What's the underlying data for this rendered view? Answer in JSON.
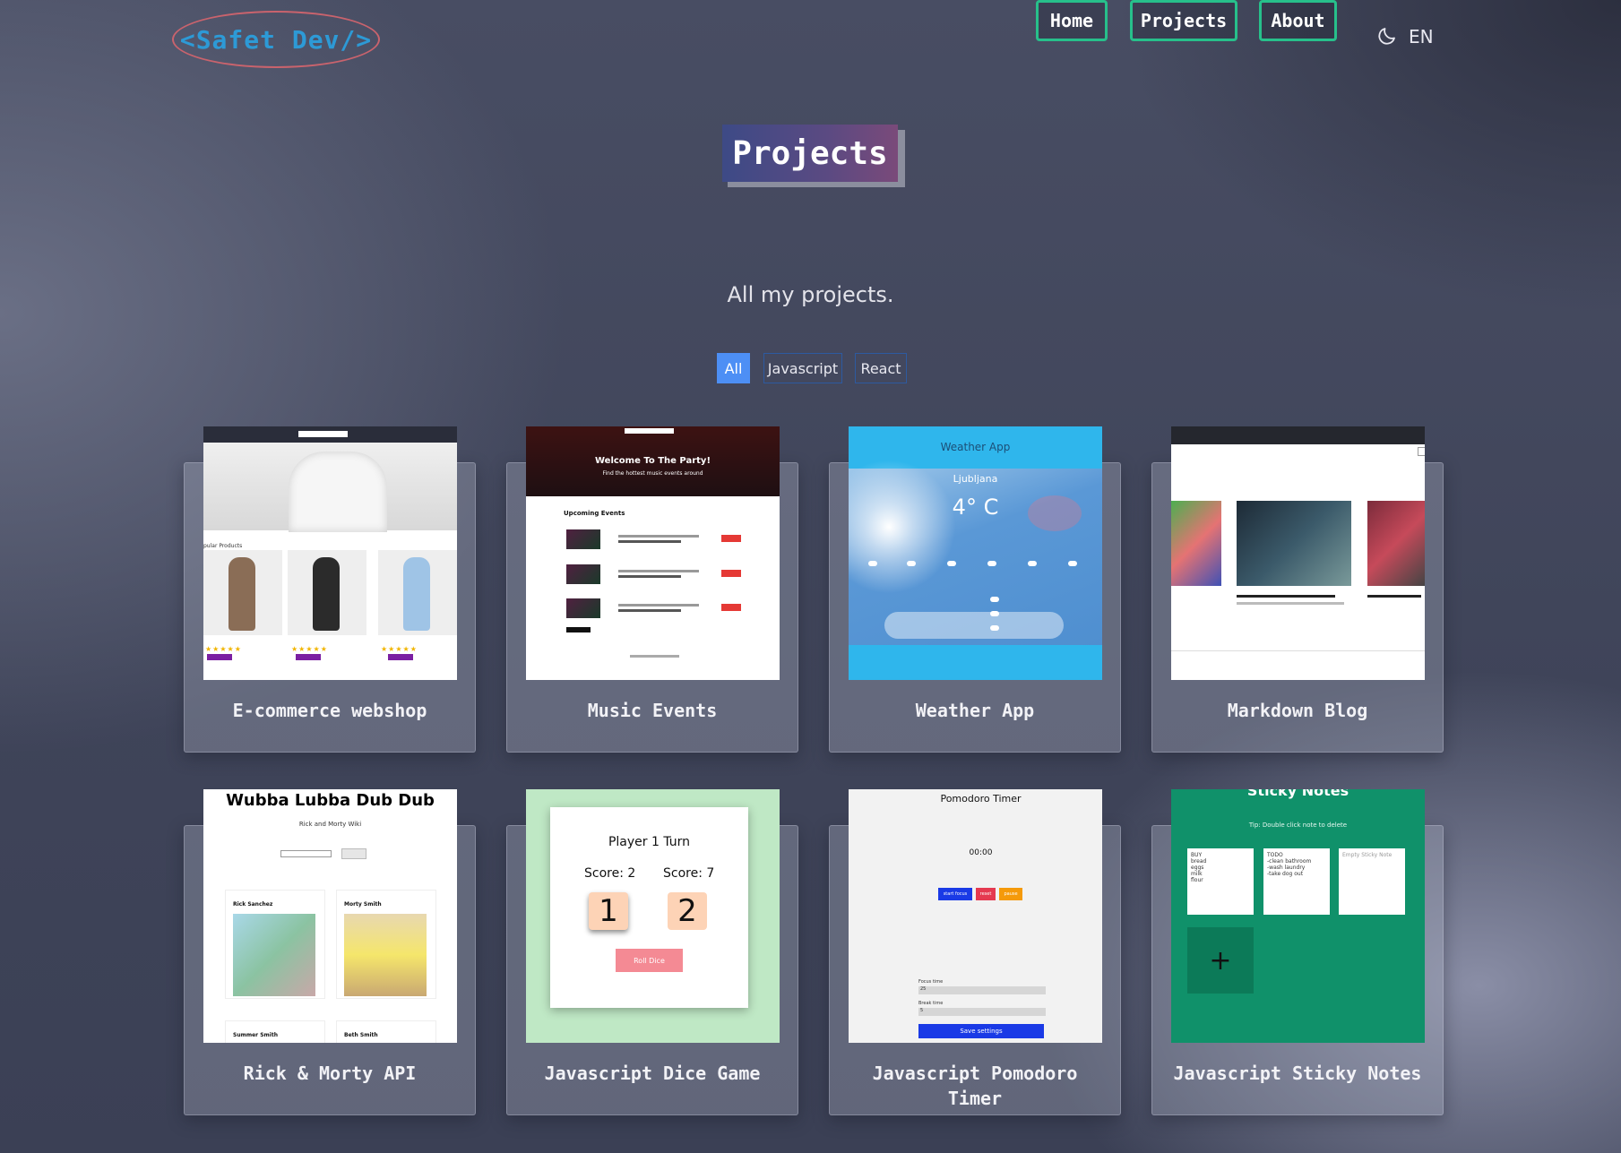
{
  "header": {
    "logo": "<Safet Dev/>",
    "nav": [
      {
        "label": "Home"
      },
      {
        "label": "Projects"
      },
      {
        "label": "About"
      }
    ],
    "theme_icon": "moon-icon",
    "language": "EN"
  },
  "page": {
    "title": "Projects",
    "subtitle": "All my projects."
  },
  "filters": [
    {
      "label": "All",
      "active": true
    },
    {
      "label": "Javascript",
      "active": false
    },
    {
      "label": "React",
      "active": false
    }
  ],
  "projects": [
    {
      "title": "E-commerce webshop"
    },
    {
      "title": "Music Events"
    },
    {
      "title": "Weather App"
    },
    {
      "title": "Markdown Blog"
    },
    {
      "title": "Rick & Morty API"
    },
    {
      "title": "Javascript Dice Game"
    },
    {
      "title": "Javascript Pomodoro Timer"
    },
    {
      "title": "Javascript Sticky Notes"
    }
  ],
  "thumbs": {
    "music": {
      "hero_title": "Welcome To The Party!",
      "hero_sub": "Find the hottest music events around",
      "section": "Upcoming Events"
    },
    "weather": {
      "header": "Weather App",
      "city": "Ljubljana",
      "temp": "4° C"
    },
    "rickmorty": {
      "title": "Wubba Lubba Dub Dub",
      "sub": "Rick and Morty Wiki",
      "names": [
        "Rick Sanchez",
        "Morty Smith",
        "Summer Smith",
        "Beth Smith"
      ]
    },
    "dice": {
      "turn": "Player 1 Turn",
      "score1": "Score: 2",
      "score2": "Score: 7",
      "die1": "1",
      "die2": "2",
      "roll": "Roll Dice"
    },
    "pomodoro": {
      "title": "Pomodoro Timer",
      "time": "00:00",
      "start": "start focus",
      "reset": "reset",
      "pause": "pause",
      "focus_label": "Focus time",
      "focus_value": "25",
      "break_label": "Break time",
      "break_value": "5",
      "save": "Save settings"
    },
    "sticky": {
      "title": "Sticky Notes",
      "tip": "Tip: Double click note to delete",
      "note1": "BUY\nbread\neggs\nmilk\nflour",
      "note2": "TODO\n-clean bathroom\n-wash laundry\n-take dog out",
      "note3": "Empty Sticky Note",
      "add": "+"
    }
  }
}
